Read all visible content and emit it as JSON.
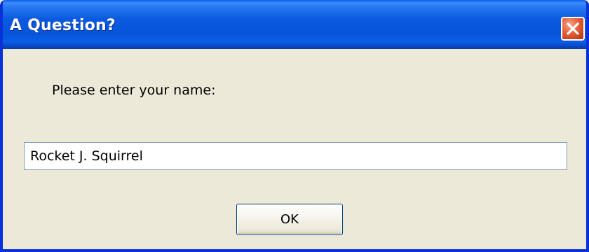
{
  "dialog": {
    "title": "A Question?",
    "prompt": "Please enter your name:",
    "name_value": "Rocket J. Squirrel",
    "ok_label": "OK"
  },
  "icons": {
    "close": "close-icon"
  },
  "colors": {
    "titlebar": "#0a5ae0",
    "window_border": "#0831d9",
    "dialog_background": "#ece9d8",
    "close_button": "#e8653f",
    "input_border": "#7f9db9",
    "button_border": "#003c74"
  }
}
